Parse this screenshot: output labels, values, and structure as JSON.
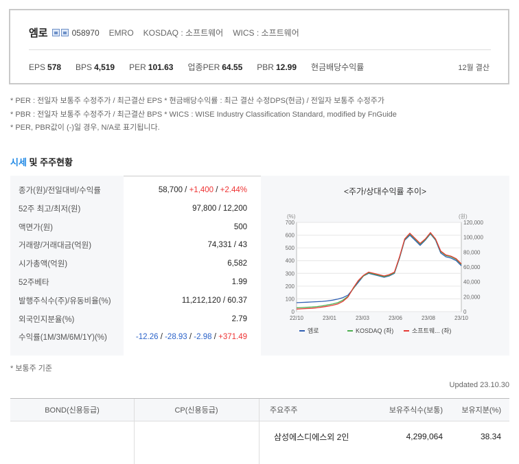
{
  "company": {
    "name": "엠로",
    "code": "058970",
    "english": "EMRO",
    "market": "KOSDAQ : 소프트웨어",
    "wics": "WICS : 소프트웨어",
    "metrics": [
      {
        "label": "EPS",
        "value": "578"
      },
      {
        "label": "BPS",
        "value": "4,519"
      },
      {
        "label": "PER",
        "value": "101.63"
      },
      {
        "label": "업종PER",
        "value": "64.55"
      },
      {
        "label": "PBR",
        "value": "12.99"
      },
      {
        "label": "현금배당수익률",
        "value": ""
      }
    ],
    "fiscal": "12월 결산"
  },
  "notes": [
    "* PER : 전일자 보통주 수정주가 / 최근결산 EPS * 현금배당수익률 : 최근 결산 수정DPS(현금) / 전일자 보통주 수정주가",
    "* PBR : 전일자 보통주 수정주가 / 최근결산 BPS * WICS : WISE Industry Classification Standard, modified by FnGuide",
    "* PER, PBR값이 (-)일 경우, N/A로 표기됩니다."
  ],
  "section": {
    "title_hl": "시세",
    "title_rest": " 및 주주현황"
  },
  "price_table": [
    {
      "label": "종가(원)/전일대비/수익률",
      "parts": [
        {
          "t": "58,700 / ",
          "c": ""
        },
        {
          "t": "+1,400",
          "c": "red"
        },
        {
          "t": " / ",
          "c": ""
        },
        {
          "t": "+2.44%",
          "c": "red"
        }
      ]
    },
    {
      "label": "52주 최고/최저(원)",
      "parts": [
        {
          "t": "97,800 / 12,200",
          "c": ""
        }
      ]
    },
    {
      "label": "액면가(원)",
      "parts": [
        {
          "t": "500",
          "c": ""
        }
      ]
    },
    {
      "label": "거래량/거래대금(억원)",
      "parts": [
        {
          "t": "74,331 / 43",
          "c": ""
        }
      ]
    },
    {
      "label": "시가총액(억원)",
      "parts": [
        {
          "t": "6,582",
          "c": ""
        }
      ]
    },
    {
      "label": "52주베타",
      "parts": [
        {
          "t": "1.99",
          "c": ""
        }
      ]
    },
    {
      "label": "발행주식수(주)/유동비율(%)",
      "parts": [
        {
          "t": "11,212,120 / 60.37",
          "c": ""
        }
      ]
    },
    {
      "label": "외국인지분율(%)",
      "parts": [
        {
          "t": "2.79",
          "c": ""
        }
      ]
    },
    {
      "label": "수익률(1M/3M/6M/1Y)(%)",
      "parts": [
        {
          "t": "-12.26",
          "c": "blue"
        },
        {
          "t": " / ",
          "c": ""
        },
        {
          "t": "-28.93",
          "c": "blue"
        },
        {
          "t": " / ",
          "c": ""
        },
        {
          "t": "-2.98",
          "c": "blue"
        },
        {
          "t": " / ",
          "c": ""
        },
        {
          "t": "+371.49",
          "c": "red"
        }
      ]
    }
  ],
  "chart_data": {
    "type": "line",
    "title": "<주가/상대수익률 추이>",
    "left_unit": "(%)",
    "right_unit": "(원)",
    "x_ticks": [
      "22/10",
      "23/01",
      "23/03",
      "23/06",
      "23/08",
      "23/10"
    ],
    "y_left_ticks": [
      "700",
      "600",
      "500",
      "400",
      "300",
      "200",
      "100",
      "0"
    ],
    "y_right_ticks": [
      "120,000",
      "100,000",
      "80,000",
      "60,000",
      "40,000",
      "20,000",
      "0"
    ],
    "ylim_left": [
      0,
      700
    ],
    "series": [
      {
        "name": "엠로",
        "color": "#2f5fb3",
        "values": [
          70,
          72,
          74,
          76,
          78,
          80,
          84,
          90,
          98,
          110,
          130,
          180,
          230,
          280,
          300,
          290,
          280,
          270,
          280,
          300,
          420,
          560,
          600,
          560,
          520,
          560,
          610,
          560,
          460,
          430,
          420,
          400,
          360
        ]
      },
      {
        "name": "KOSDAQ (좌)",
        "color": "#4caf50",
        "values": [
          30,
          32,
          34,
          36,
          40,
          45,
          52,
          60,
          70,
          90,
          120,
          180,
          240,
          280,
          305,
          295,
          285,
          275,
          285,
          305,
          425,
          565,
          610,
          570,
          530,
          565,
          615,
          565,
          470,
          440,
          430,
          410,
          370
        ]
      },
      {
        "name": "소프트웨... (좌)",
        "color": "#e53935",
        "values": [
          20,
          22,
          24,
          26,
          30,
          36,
          42,
          50,
          60,
          80,
          115,
          185,
          245,
          285,
          310,
          300,
          290,
          280,
          290,
          310,
          430,
          570,
          615,
          575,
          535,
          570,
          620,
          570,
          475,
          445,
          435,
          415,
          375
        ]
      }
    ],
    "legend": [
      "엠로",
      "KOSDAQ (좌)",
      "소프트웨... (좌)"
    ]
  },
  "basis": "* 보통주 기준",
  "updated": "Updated 23.10.30",
  "bottom": {
    "headers": [
      "BOND(신용등급)",
      "CP(신용등급)",
      "주요주주",
      "보유주식수(보통)",
      "보유지분(%)"
    ],
    "row": {
      "holder": "삼성에스디에스외 2인",
      "shares": "4,299,064",
      "pct": "38.34"
    }
  },
  "colors": {
    "accent": "#1e88e5",
    "up": "#ee3333",
    "down": "#2a62c9"
  }
}
